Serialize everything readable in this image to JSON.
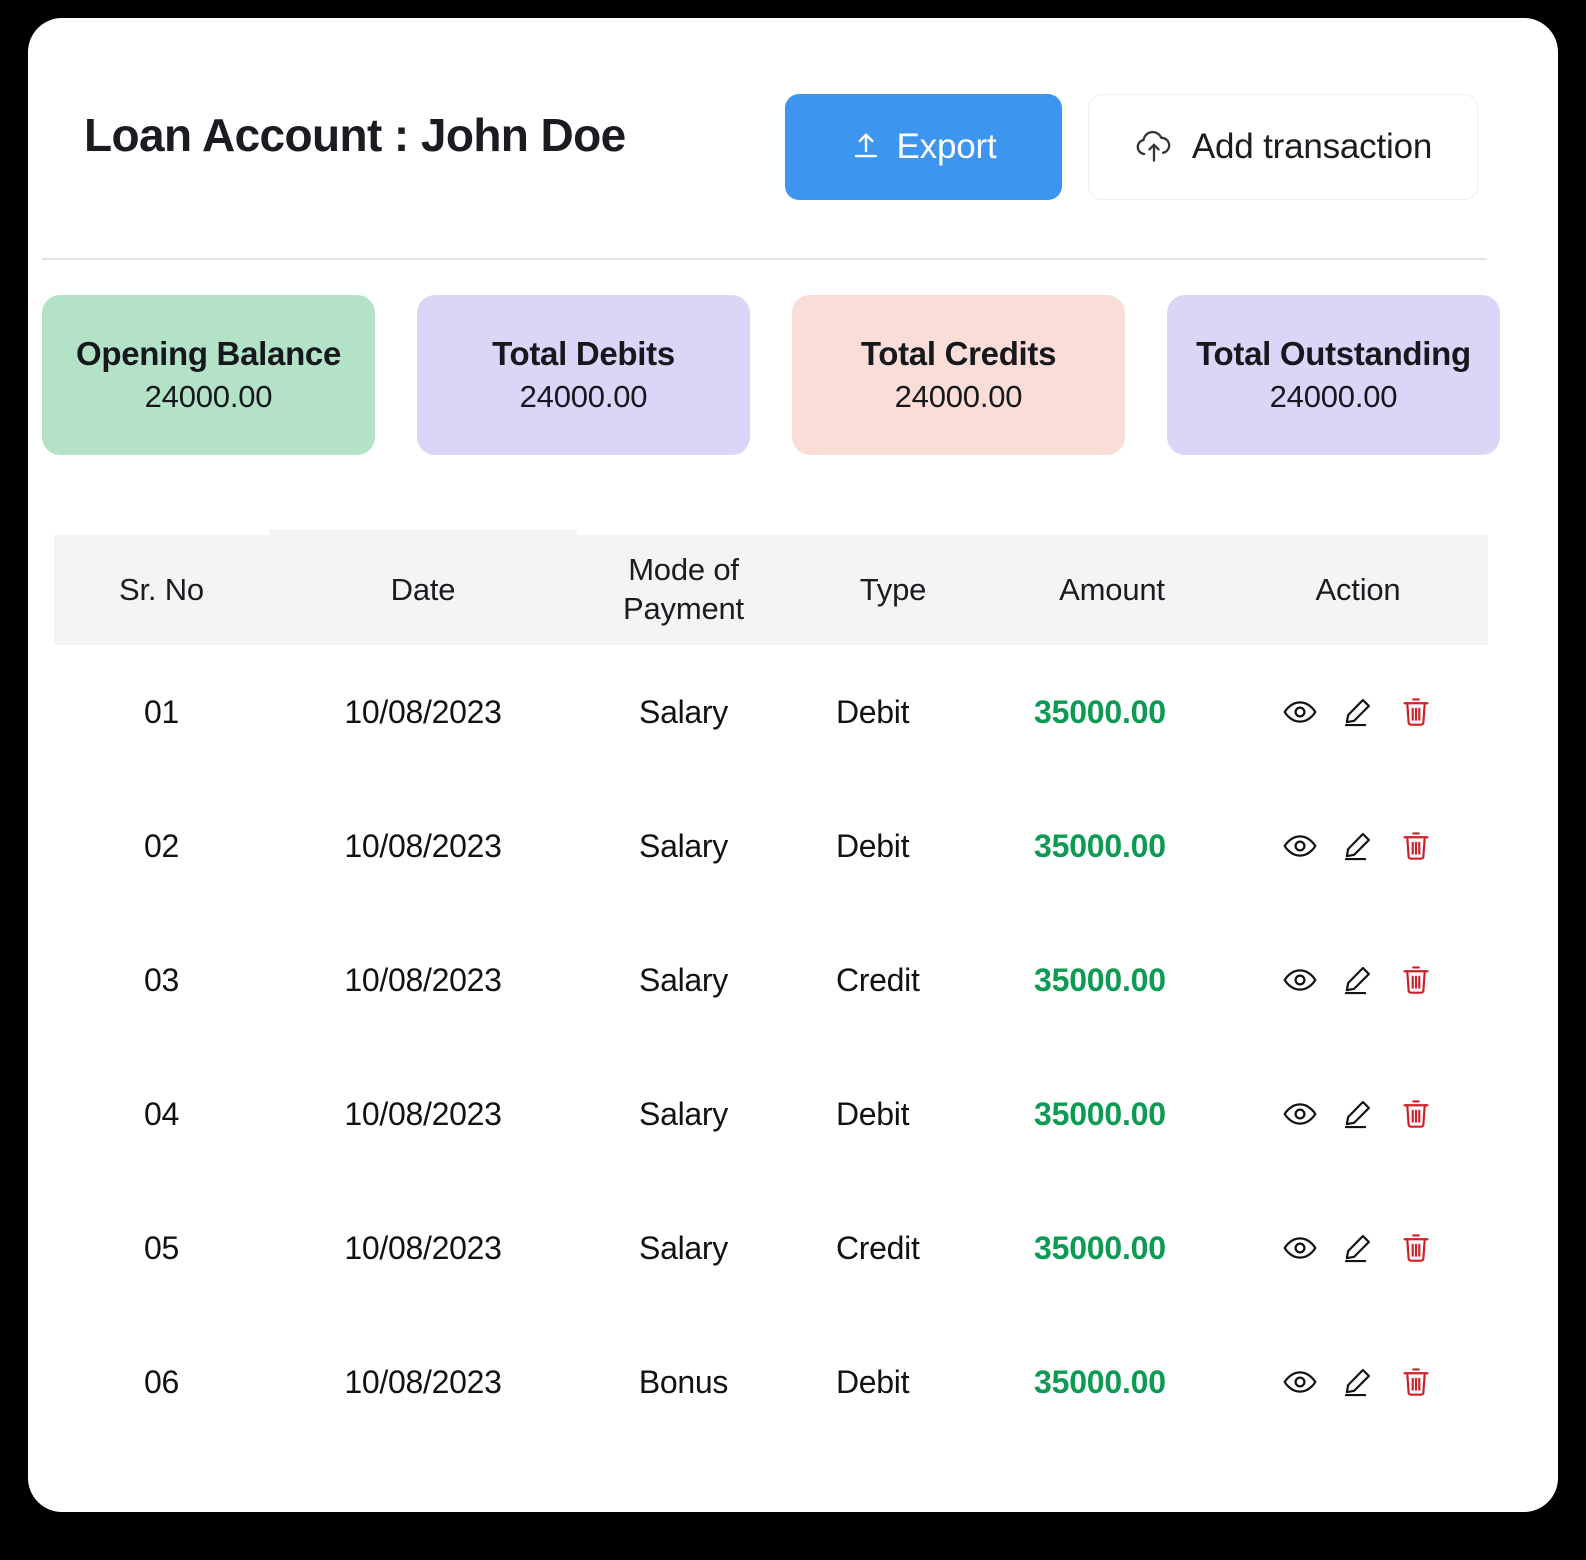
{
  "header": {
    "title": "Loan Account : John Doe",
    "export_label": "Export",
    "export_icon": "upload-arrow-icon",
    "add_label": "Add transaction",
    "add_icon": "cloud-upload-icon",
    "accent_blue": "#3c96ef"
  },
  "summary": [
    {
      "label": "Opening Balance",
      "value": "24000.00",
      "color": "#b3e2c6"
    },
    {
      "label": "Total Debits",
      "value": "24000.00",
      "color": "#ddd5f7"
    },
    {
      "label": "Total Credits",
      "value": "24000.00",
      "color": "#f9ddd6"
    },
    {
      "label": "Total Outstanding",
      "value": "24000.00",
      "color": "#ddd5f8"
    }
  ],
  "table": {
    "columns": [
      "Sr. No",
      "Date",
      "Mode of Payment",
      "Type",
      "Amount",
      "Action"
    ],
    "amount_color": "#0d9b54",
    "delete_color": "#cc2128",
    "rows": [
      {
        "sr": "01",
        "date": "10/08/2023",
        "mode": "Salary",
        "type": "Debit",
        "amount": "35000.00"
      },
      {
        "sr": "02",
        "date": "10/08/2023",
        "mode": "Salary",
        "type": "Debit",
        "amount": "35000.00"
      },
      {
        "sr": "03",
        "date": "10/08/2023",
        "mode": "Salary",
        "type": "Credit",
        "amount": "35000.00"
      },
      {
        "sr": "04",
        "date": "10/08/2023",
        "mode": "Salary",
        "type": "Debit",
        "amount": "35000.00"
      },
      {
        "sr": "05",
        "date": "10/08/2023",
        "mode": "Salary",
        "type": "Credit",
        "amount": "35000.00"
      },
      {
        "sr": "06",
        "date": "10/08/2023",
        "mode": "Bonus",
        "type": "Debit",
        "amount": "35000.00"
      }
    ]
  }
}
